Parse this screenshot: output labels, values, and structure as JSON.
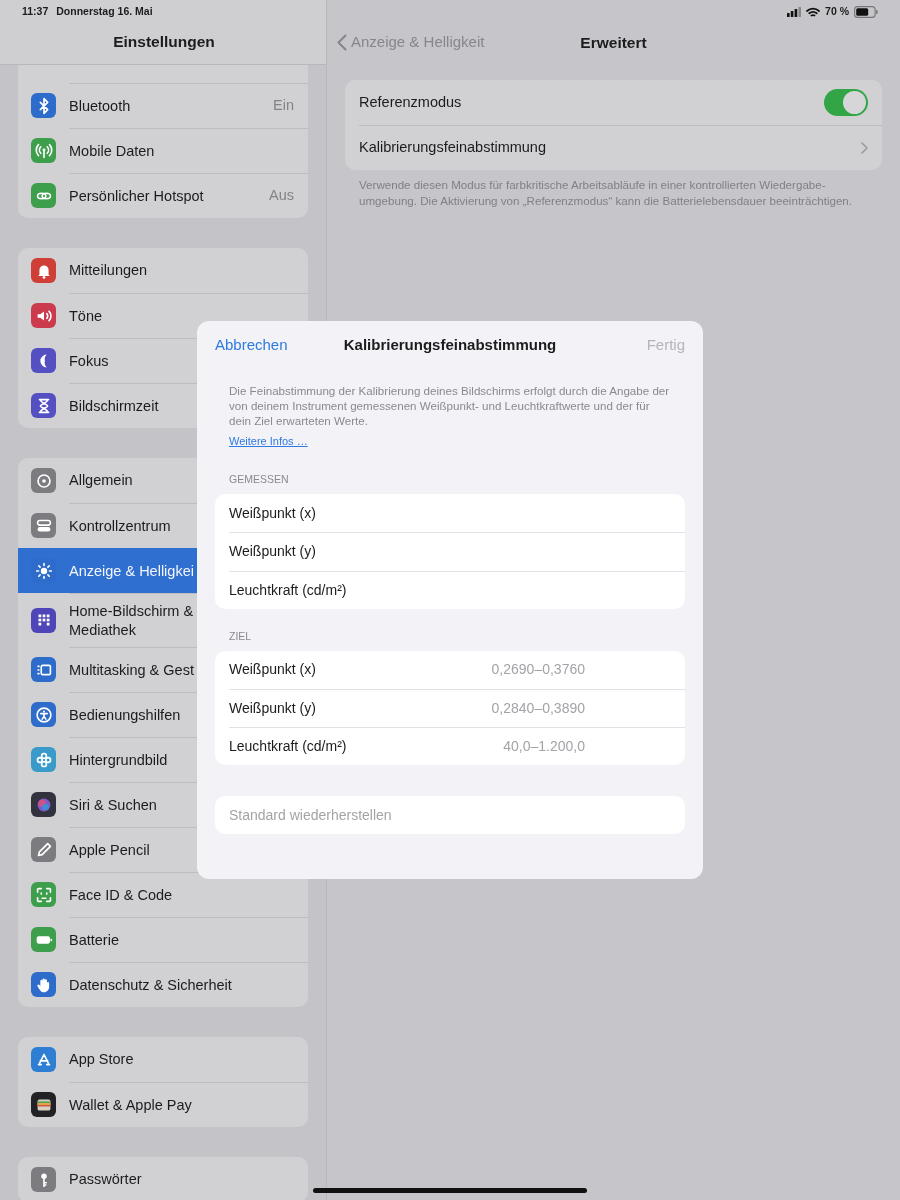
{
  "status_bar": {
    "time": "11:37",
    "date": "Donnerstag 16. Mai",
    "battery": "70 %"
  },
  "sidebar": {
    "title": "Einstellungen",
    "groups": [
      {
        "items": [
          {
            "label": "Bluetooth",
            "value": "Ein",
            "kind": "bluetooth",
            "color": "#2e6ccc",
            "selected": false
          },
          {
            "label": "Mobile Daten",
            "kind": "antenna",
            "color": "#3d9e4c",
            "selected": false
          },
          {
            "label": "Persönlicher Hotspot",
            "value": "Aus",
            "kind": "link",
            "color": "#3d9e4c",
            "selected": false
          }
        ]
      },
      {
        "items": [
          {
            "label": "Mitteilungen",
            "kind": "bell",
            "color": "#cf3f38",
            "selected": false
          },
          {
            "label": "Töne",
            "kind": "speaker",
            "color": "#cc3a4e",
            "selected": false
          },
          {
            "label": "Fokus",
            "kind": "moon",
            "color": "#5450c2",
            "selected": false
          },
          {
            "label": "Bildschirmzeit",
            "kind": "hourglass",
            "color": "#5450c2",
            "selected": false
          }
        ]
      },
      {
        "items": [
          {
            "label": "Allgemein",
            "kind": "gear",
            "color": "#7b7b80",
            "selected": false
          },
          {
            "label": "Kontrollzentrum",
            "kind": "switches",
            "color": "#7b7b80",
            "selected": false
          },
          {
            "label": "Anzeige & Helligkei",
            "kind": "sun",
            "color": "#2e6ccc",
            "selected": true
          },
          {
            "label": "Home-Bildschirm &\nMediathek",
            "kind": "grid",
            "color": "#4e46b8",
            "selected": false
          },
          {
            "label": "Multitasking & Gest",
            "kind": "windows",
            "color": "#2e6ccc",
            "selected": false
          },
          {
            "label": "Bedienungshilfen",
            "kind": "person",
            "color": "#2e6ccc",
            "selected": false
          },
          {
            "label": "Hintergrundbild",
            "kind": "flower",
            "color": "#3a9ac9",
            "selected": false
          },
          {
            "label": "Siri & Suchen",
            "kind": "orb",
            "color": "#333340",
            "selected": false
          },
          {
            "label": "Apple Pencil",
            "kind": "pencil",
            "color": "#7b7b80",
            "selected": false
          },
          {
            "label": "Face ID & Code",
            "kind": "face",
            "color": "#3d9e4c",
            "selected": false
          },
          {
            "label": "Batterie",
            "kind": "battery",
            "color": "#3d9e4c",
            "selected": false
          },
          {
            "label": "Datenschutz & Sicherheit",
            "kind": "hand",
            "color": "#2e6ccc",
            "selected": false
          }
        ]
      },
      {
        "items": [
          {
            "label": "App Store",
            "kind": "store",
            "color": "#2e7fd4",
            "selected": false
          },
          {
            "label": "Wallet & Apple Pay",
            "kind": "wallet",
            "color": "#222226",
            "selected": false
          }
        ]
      },
      {
        "items": [
          {
            "label": "Passwörter",
            "kind": "key",
            "color": "#7b7b80",
            "selected": false
          }
        ]
      }
    ]
  },
  "detail": {
    "back": "Anzeige & Helligkeit",
    "title": "Erweitert",
    "rows": [
      {
        "label": "Referenzmodus",
        "kind": "toggle",
        "on": true
      },
      {
        "label": "Kalibrierungsfeinabstimmung",
        "kind": "link"
      }
    ],
    "footer": "Verwende diesen Modus für farbkritische Arbeitsabläufe in einer kontrollierten Wiedergabe-umgebung. Die Aktivierung von „Referenzmodus“ kann die Batterielebensdauer beeinträchtigen."
  },
  "dialog": {
    "cancel": "Abbrechen",
    "title": "Kalibrierungsfeinabstimmung",
    "done": {
      "label": "Fertig",
      "disabled": true
    },
    "description": "Die Feinabstimmung der Kalibrierung deines Bildschirms erfolgt durch die Angabe der von deinem Instrument gemessenen Weißpunkt- und Leuchtkraftwerte und der für dein Ziel erwarteten Werte.",
    "more_link": "Weitere Infos …",
    "sections": [
      {
        "header": "GEMESSEN",
        "fields": [
          {
            "label": "Weißpunkt (x)"
          },
          {
            "label": "Weißpunkt (y)"
          },
          {
            "label": "Leuchtkraft (cd/m²)"
          }
        ]
      },
      {
        "header": "ZIEL",
        "fields": [
          {
            "label": "Weißpunkt (x)",
            "placeholder": "0,2690–0,3760"
          },
          {
            "label": "Weißpunkt (y)",
            "placeholder": "0,2840–0,3890"
          },
          {
            "label": "Leuchtkraft (cd/m²)",
            "placeholder": "40,0–1.200,0"
          }
        ]
      }
    ],
    "reset": {
      "label": "Standard wiederherstellen",
      "disabled": true
    }
  }
}
